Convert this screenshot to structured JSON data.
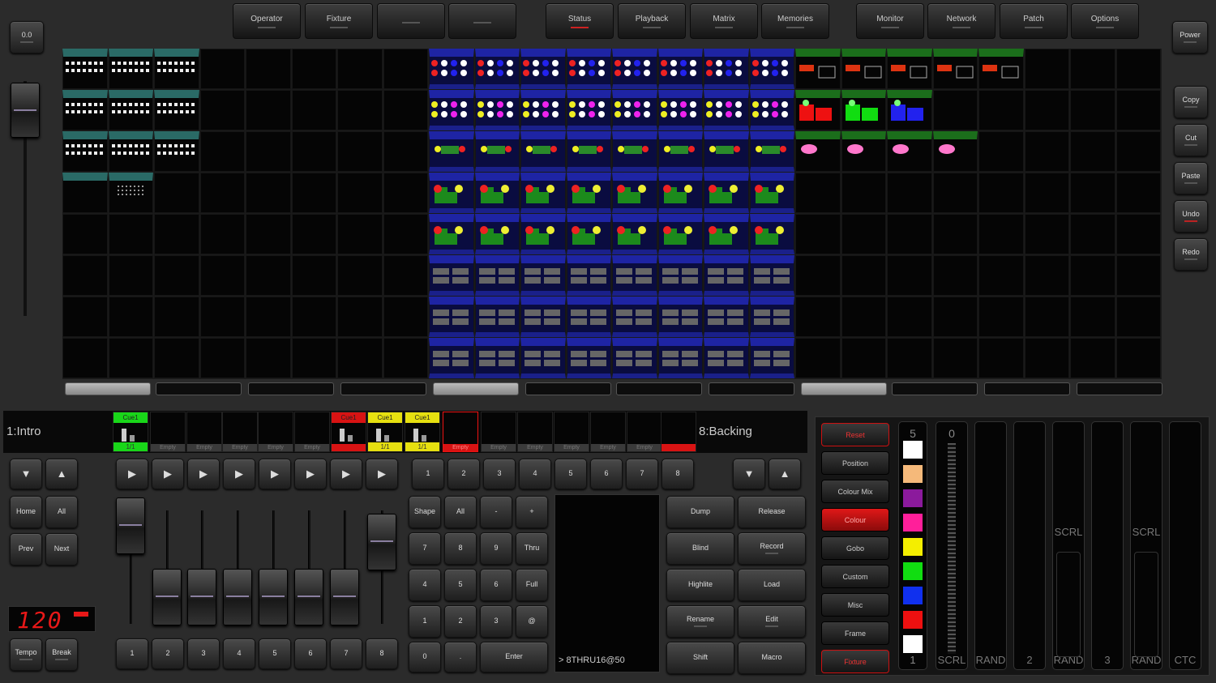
{
  "top_tabs": [
    {
      "label": "Operator",
      "sub_color": "#555"
    },
    {
      "label": "Fixture",
      "sub_color": "#555"
    },
    {
      "label": "",
      "sub_color": "#555"
    },
    {
      "label": "",
      "sub_color": "#555"
    },
    {
      "label": "Status",
      "sub_color": "#c22"
    },
    {
      "label": "Playback",
      "sub_color": "#555"
    },
    {
      "label": "Matrix",
      "sub_color": "#555"
    },
    {
      "label": "Memories",
      "sub_color": "#555"
    },
    {
      "label": "Monitor",
      "sub_color": "#555"
    },
    {
      "label": "Network",
      "sub_color": "#555"
    },
    {
      "label": "Patch",
      "sub_color": "#555"
    },
    {
      "label": "Options",
      "sub_color": "#555"
    }
  ],
  "top_left_button": "0.0",
  "power_button": "Power",
  "right_side_buttons": [
    "Copy",
    "Cut",
    "Paste",
    "Undo",
    "Redo"
  ],
  "playback": {
    "left_name": "1:Intro",
    "right_name": "8:Backing",
    "slots": [
      {
        "label": "Empty",
        "state": "active-green",
        "top": "Cue1",
        "val": "1/1"
      },
      {
        "label": "Empty",
        "state": "empty"
      },
      {
        "label": "Empty",
        "state": "empty"
      },
      {
        "label": "Empty",
        "state": "empty"
      },
      {
        "label": "Empty",
        "state": "empty"
      },
      {
        "label": "Empty",
        "state": "empty"
      },
      {
        "label": "",
        "state": "red",
        "top": "Cue1"
      },
      {
        "label": "",
        "state": "yellow",
        "top": "Cue1",
        "val": "1/1"
      },
      {
        "label": "",
        "state": "yellow",
        "top": "Cue1",
        "val": "1/1"
      },
      {
        "label": "Empty",
        "state": "red-outline"
      },
      {
        "label": "Empty",
        "state": "empty"
      },
      {
        "label": "Empty",
        "state": "empty"
      },
      {
        "label": "Empty",
        "state": "empty"
      },
      {
        "label": "Empty",
        "state": "empty"
      },
      {
        "label": "Empty",
        "state": "empty"
      },
      {
        "label": "",
        "state": "red"
      }
    ]
  },
  "nav": {
    "up": "▼",
    "down": "▲",
    "home": "Home",
    "all": "All",
    "prev": "Prev",
    "next": "Next"
  },
  "bpm_display": "120",
  "tempo": {
    "tempo": "Tempo",
    "break": "Break"
  },
  "numeric_keys": {
    "row1": [
      "Shape",
      "All",
      "-",
      "+"
    ],
    "row2": [
      "7",
      "8",
      "9",
      "Thru"
    ],
    "row3": [
      "4",
      "5",
      "6",
      "Full"
    ],
    "row4": [
      "1",
      "2",
      "3",
      "@"
    ],
    "row5": [
      "0",
      ".",
      "Enter"
    ]
  },
  "command_line": "> 8THRU16@50",
  "func_buttons": [
    "Dump",
    "Release",
    "Blind",
    "Record",
    "Highlite",
    "Load",
    "Rename",
    "Edit",
    "Shift",
    "Macro"
  ],
  "attr_buttons": [
    "Reset",
    "Position",
    "Colour Mix",
    "Colour",
    "Gobo",
    "Custom",
    "Misc",
    "Frame",
    "Fixture"
  ],
  "swatches": {
    "num": "5",
    "colors": [
      "#ffffff",
      "#f5b97a",
      "#8b1a9c",
      "#ff1f9a",
      "#f4ee00",
      "#11dd11",
      "#1030ee",
      "#ee1010",
      "#ffffff"
    ],
    "bottom": "1"
  },
  "master_slots": [
    {
      "top": "0",
      "bottom": "SCRL"
    },
    {
      "top": "",
      "bottom": "RAND"
    },
    {
      "top": "",
      "bottom": "2"
    },
    {
      "top": "",
      "mid": "SCRL",
      "bottom": "RAND"
    },
    {
      "top": "",
      "bottom": "3"
    },
    {
      "top": "",
      "mid": "SCRL",
      "bottom": "RAND"
    },
    {
      "top": "",
      "bottom": "CTC"
    }
  ],
  "colors": {
    "teal": "#2a6a66",
    "blue": "#1e24a4",
    "green": "#1b6e1b",
    "red": "#d81313",
    "yellow": "#e6e010",
    "green_active": "#19d619"
  }
}
